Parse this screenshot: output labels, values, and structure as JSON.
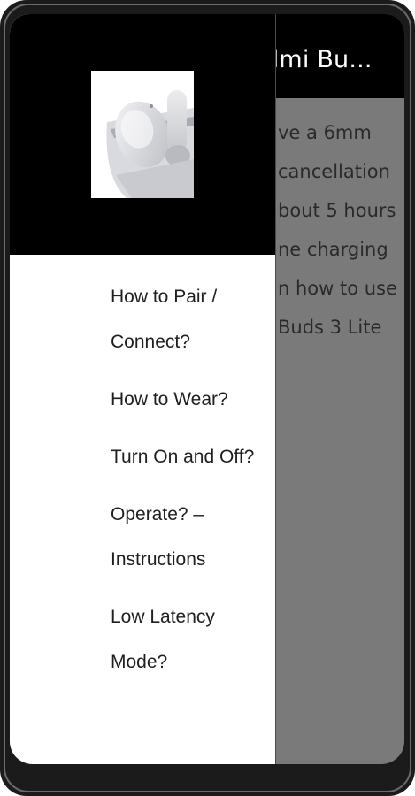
{
  "app_bar": {
    "title": "dmi Bu..."
  },
  "background_content": {
    "lines": [
      "ve a 6mm",
      "cancellation",
      "bout 5 hours",
      "ne charging",
      "n how to use",
      "Buds 3 Lite"
    ]
  },
  "drawer": {
    "header_image": "earbuds-case-image",
    "items": [
      {
        "label": "How to Pair / Connect?"
      },
      {
        "label": "How to Wear?"
      },
      {
        "label": "Turn On and Off?"
      },
      {
        "label": "Operate? – Instructions"
      },
      {
        "label": "Low Latency Mode?"
      }
    ]
  },
  "colors": {
    "header": "#000000",
    "drawer": "#ffffff",
    "scrim": "#7a7a7a",
    "menu_text": "#1f1f1f"
  }
}
